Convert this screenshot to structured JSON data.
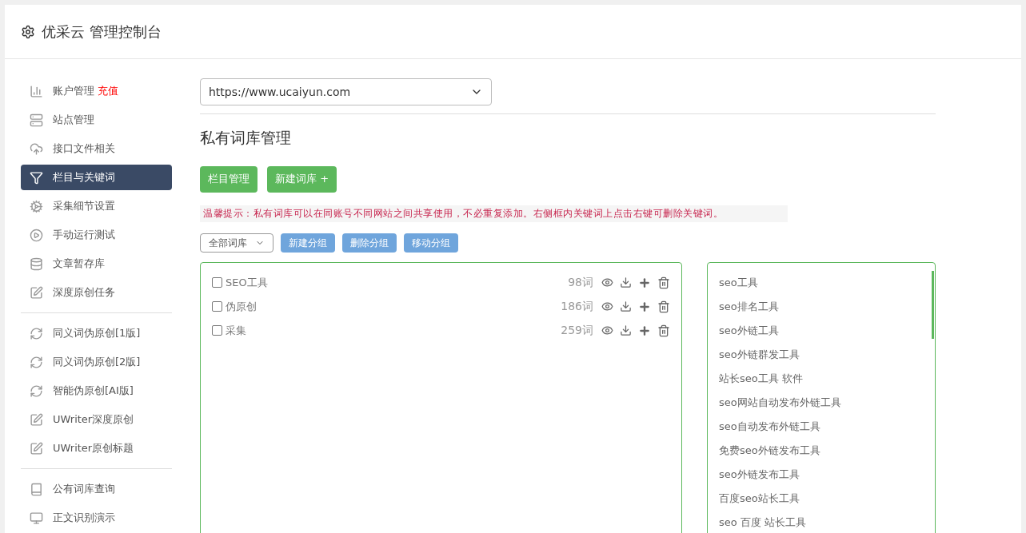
{
  "header": {
    "title": "优采云 管理控制台"
  },
  "sidebar": {
    "groups": [
      {
        "items": [
          {
            "label": "账户管理",
            "badge": "充值",
            "selected": false
          },
          {
            "label": "站点管理",
            "selected": false
          },
          {
            "label": "接口文件相关",
            "selected": false
          },
          {
            "label": "栏目与关键词",
            "selected": true
          },
          {
            "label": "采集细节设置",
            "selected": false
          },
          {
            "label": "手动运行测试",
            "selected": false
          },
          {
            "label": "文章暂存库",
            "selected": false
          },
          {
            "label": "深度原创任务",
            "selected": false
          }
        ]
      },
      {
        "items": [
          {
            "label": "同义词伪原创[1版]",
            "selected": false
          },
          {
            "label": "同义词伪原创[2版]",
            "selected": false
          },
          {
            "label": "智能伪原创[AI版]",
            "selected": false
          },
          {
            "label": "UWriter深度原创",
            "selected": false
          },
          {
            "label": "UWriter原创标题",
            "selected": false
          }
        ]
      },
      {
        "items": [
          {
            "label": "公有词库查询",
            "selected": false
          },
          {
            "label": "正文识别演示",
            "selected": false
          }
        ]
      }
    ]
  },
  "site_select": {
    "value": "https://www.ucaiyun.com"
  },
  "page_title": "私有词库管理",
  "action_buttons": [
    "栏目管理",
    "新建词库 +"
  ],
  "notice": "温馨提示：私有词库可以在同账号不同网站之间共享使用，不必重复添加。右侧框内关键词上点击右键可删除关键词。",
  "group_select": {
    "value": "全部词库"
  },
  "group_buttons": [
    "新建分组",
    "删除分组",
    "移动分组"
  ],
  "libraries": [
    {
      "name": "SEO工具",
      "count": "98词",
      "checked": false
    },
    {
      "name": "伪原创",
      "count": "186词",
      "checked": false
    },
    {
      "name": "采集",
      "count": "259词",
      "checked": false
    }
  ],
  "keywords": [
    "seo工具",
    "seo排名工具",
    "seo外链工具",
    "seo外链群发工具",
    "站长seo工具 软件",
    "seo网站自动发布外链工具",
    "seo自动发布外链工具",
    "免费seo外链发布工具",
    "seo外链发布工具",
    "百度seo站长工具",
    "seo 百度 站长工具"
  ]
}
